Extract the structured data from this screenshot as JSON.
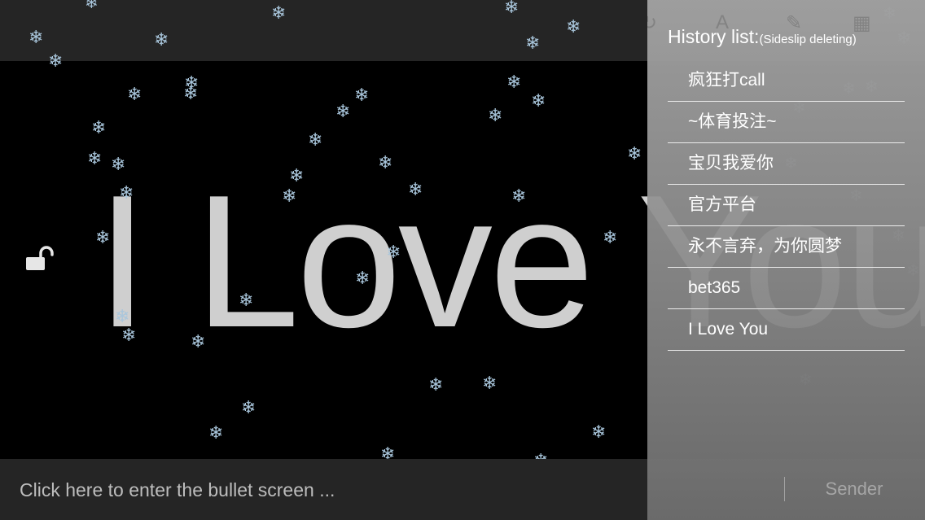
{
  "screen": {
    "bullet_text": "I Love You",
    "input_placeholder": "Click here to enter the bullet screen ..."
  },
  "history_panel": {
    "title": "History list:",
    "subtitle": "(Sideslip deleting)",
    "items": [
      "疯狂打call",
      "~体育投注~",
      "宝贝我爱你",
      "官方平台",
      "永不言弃，为你圆梦",
      "bet365",
      "I Love You"
    ],
    "send_label": "Sender"
  },
  "icons": {
    "lock": "unlock-icon",
    "snowflake": "snowflake-icon"
  },
  "colors": {
    "background": "#000000",
    "bar": "#252525",
    "text": "#cfcfcf",
    "snow": "#a9c6dc"
  }
}
